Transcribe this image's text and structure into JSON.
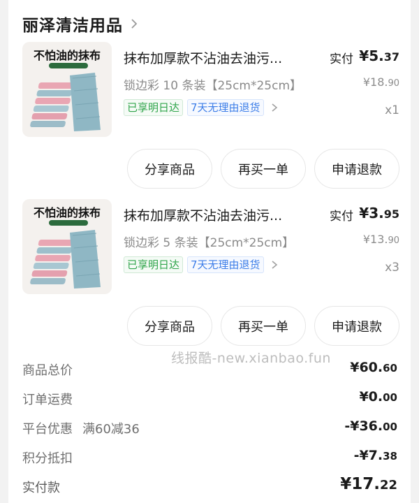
{
  "store": {
    "name": "丽泽清洁用品"
  },
  "items": [
    {
      "thumb_title": "不怕油的抹布",
      "title": "抹布加厚款不沾油去油污...",
      "paid_label": "实付",
      "paid_price_int": "¥5.",
      "paid_price_dec": "37",
      "variant": "锁边彩 10 条装【25cm*25cm】",
      "orig_price_int": "¥18.",
      "orig_price_dec": "90",
      "tag1": "已享明日达",
      "tag2": "7天无理由退货",
      "qty": "x1",
      "actions": [
        "分享商品",
        "再买一单",
        "申请退款"
      ]
    },
    {
      "thumb_title": "不怕油的抹布",
      "title": "抹布加厚款不沾油去油污...",
      "paid_label": "实付",
      "paid_price_int": "¥3.",
      "paid_price_dec": "95",
      "variant": "锁边彩 5 条装【25cm*25cm】",
      "orig_price_int": "¥13.",
      "orig_price_dec": "90",
      "tag1": "已享明日达",
      "tag2": "7天无理由退货",
      "qty": "x3",
      "actions": [
        "分享商品",
        "再买一单",
        "申请退款"
      ]
    }
  ],
  "watermark": "线报酷-new.xianbao.fun",
  "summary": {
    "total_label": "商品总价",
    "total_int": "¥60.",
    "total_dec": "60",
    "shipping_label": "订单运费",
    "shipping_int": "¥0.",
    "shipping_dec": "00",
    "discount_label": "平台优惠",
    "discount_note": "满60减36",
    "discount_int": "-¥36.",
    "discount_dec": "00",
    "points_label": "积分抵扣",
    "points_int": "-¥7.",
    "points_dec": "38",
    "paid_label": "实付款",
    "paid_int": "¥17.",
    "paid_dec": "22"
  },
  "colors": {
    "tag_green": "#2fa44a",
    "tag_blue": "#3d7ee8",
    "towel_pink": "#e9a6b3",
    "towel_blue": "#8fb7c4"
  }
}
